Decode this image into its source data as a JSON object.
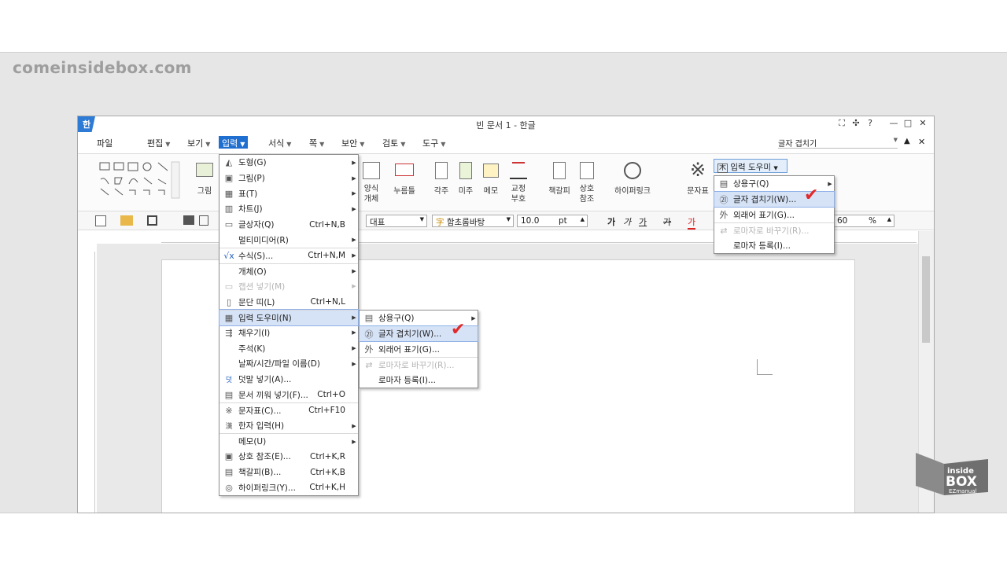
{
  "watermark": "comeinsidebox.com",
  "app": {
    "logo": "한",
    "title": "빈 문서 1 - 한글",
    "window_buttons": [
      "⛶",
      "✣",
      "?",
      "—",
      "□",
      "✕"
    ],
    "search_box": "글자 겹치기",
    "menubar_tail": [
      "▲",
      "✕"
    ]
  },
  "menubar": [
    {
      "label": "파일",
      "has_arrow": false
    },
    {
      "label": "편집",
      "has_arrow": true
    },
    {
      "label": "보기",
      "has_arrow": true
    },
    {
      "label": "입력",
      "has_arrow": true,
      "active": true
    },
    {
      "label": "서식",
      "has_arrow": true
    },
    {
      "label": "쪽",
      "has_arrow": true
    },
    {
      "label": "보안",
      "has_arrow": true
    },
    {
      "label": "검토",
      "has_arrow": true
    },
    {
      "label": "도구",
      "has_arrow": true
    }
  ],
  "ribbon": {
    "picture": "그림",
    "form": [
      "양식",
      "개체"
    ],
    "press_frame": "누름틀",
    "footnote": "각주",
    "endnote": "미주",
    "memo": "메모",
    "proof": [
      "교정",
      "부호"
    ],
    "bookmark": "책갈피",
    "cross_ref": [
      "상호",
      "참조"
    ],
    "hyperlink": "하이퍼링크",
    "charmap": "문자표",
    "input_helper": "입력 도우미"
  },
  "toolbar2": {
    "style": "대표",
    "font": "함초롬바탕",
    "size": "10.0",
    "unit": "pt",
    "zoom": "60",
    "zoom_unit": "%",
    "format_buttons": [
      "가",
      "가",
      "가",
      "가",
      "가"
    ]
  },
  "insert_menu": [
    {
      "icon": "◭",
      "label": "도형(G)",
      "shortcut": "",
      "arrow": true
    },
    {
      "icon": "▣",
      "label": "그림(P)",
      "shortcut": "",
      "arrow": true
    },
    {
      "icon": "▦",
      "label": "표(T)",
      "shortcut": "",
      "arrow": true
    },
    {
      "icon": "▥",
      "label": "차트(J)",
      "shortcut": "",
      "arrow": true
    },
    {
      "icon": "▭",
      "label": "글상자(Q)",
      "shortcut": "Ctrl+N,B",
      "arrow": false
    },
    {
      "icon": "",
      "label": "멀티미디어(R)",
      "shortcut": "",
      "arrow": true
    },
    {
      "icon": "√x",
      "label": "수식(S)...",
      "shortcut": "Ctrl+N,M",
      "arrow": true,
      "sep": true
    },
    {
      "icon": "",
      "label": "개체(O)",
      "shortcut": "",
      "arrow": true,
      "sep": true
    },
    {
      "icon": "▭",
      "label": "캡션 넣기(M)",
      "shortcut": "",
      "arrow": true,
      "disabled": true
    },
    {
      "icon": "▯",
      "label": "문단 띠(L)",
      "shortcut": "Ctrl+N,L",
      "arrow": false
    },
    {
      "icon": "▦",
      "label": "입력 도우미(N)",
      "shortcut": "",
      "arrow": true,
      "highlight": true,
      "sep": true
    },
    {
      "icon": "⇶",
      "label": "채우기(I)",
      "shortcut": "",
      "arrow": true
    },
    {
      "icon": "",
      "label": "주석(K)",
      "shortcut": "",
      "arrow": true
    },
    {
      "icon": "",
      "label": "날짜/시간/파일 이름(D)",
      "shortcut": "",
      "arrow": true
    },
    {
      "icon": "덧",
      "label": "덧말 넣기(A)...",
      "shortcut": "",
      "arrow": false
    },
    {
      "icon": "▤",
      "label": "문서 끼워 넣기(F)...",
      "shortcut": "Ctrl+O",
      "arrow": false
    },
    {
      "icon": "※",
      "label": "문자표(C)...",
      "shortcut": "Ctrl+F10",
      "arrow": false,
      "sep": true
    },
    {
      "icon": "漢",
      "label": "한자 입력(H)",
      "shortcut": "",
      "arrow": true
    },
    {
      "icon": "",
      "label": "메모(U)",
      "shortcut": "",
      "arrow": true,
      "sep": true
    },
    {
      "icon": "▣",
      "label": "상호 참조(E)...",
      "shortcut": "Ctrl+K,R",
      "arrow": false
    },
    {
      "icon": "▤",
      "label": "책갈피(B)...",
      "shortcut": "Ctrl+K,B",
      "arrow": false
    },
    {
      "icon": "◎",
      "label": "하이퍼링크(Y)...",
      "shortcut": "Ctrl+K,H",
      "arrow": false
    }
  ],
  "helper_submenu": [
    {
      "icon": "▤",
      "label": "상용구(Q)",
      "arrow": true
    },
    {
      "icon": "㉑",
      "label": "글자 겹치기(W)...",
      "arrow": false,
      "highlight": true
    },
    {
      "icon": "外",
      "label": "외래어 표기(G)...",
      "arrow": false
    },
    {
      "icon": "⇄",
      "label": "로마자로 바꾸기(R)...",
      "arrow": false,
      "disabled": true,
      "sep": true
    },
    {
      "icon": "",
      "label": "로마자 등록(I)...",
      "arrow": false
    }
  ],
  "ribbon_helper_menu": [
    {
      "icon": "▤",
      "label": "상용구(Q)",
      "arrow": true
    },
    {
      "icon": "㉑",
      "label": "글자 겹치기(W)...",
      "arrow": false,
      "highlight": true
    },
    {
      "icon": "外",
      "label": "외래어 표기(G)...",
      "arrow": false
    },
    {
      "icon": "⇄",
      "label": "로마자로 바꾸기(R)...",
      "arrow": false,
      "disabled": true,
      "sep": true
    },
    {
      "icon": "",
      "label": "로마자 등록(I)...",
      "arrow": false
    }
  ],
  "checkmark": "✔",
  "brand_logo": {
    "line1": "inside",
    "line2": "BOX",
    "line3": "EZmanual"
  }
}
